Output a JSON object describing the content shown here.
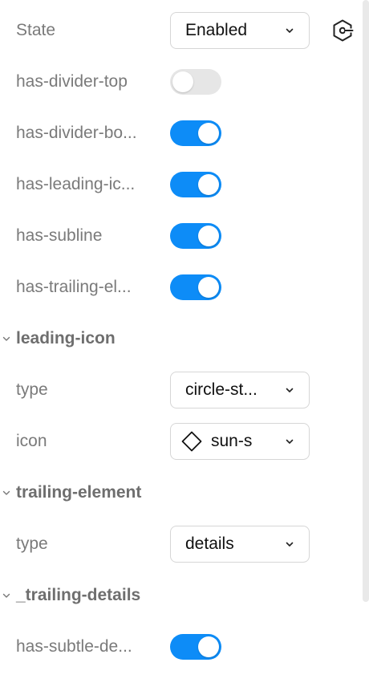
{
  "state": {
    "label": "State",
    "value": "Enabled"
  },
  "toggles": {
    "has_divider_top": {
      "label": "has-divider-top",
      "on": false
    },
    "has_divider_bottom": {
      "label": "has-divider-bo...",
      "on": true
    },
    "has_leading_icon": {
      "label": "has-leading-ic...",
      "on": true
    },
    "has_subline": {
      "label": "has-subline",
      "on": true
    },
    "has_trailing_element": {
      "label": "has-trailing-el...",
      "on": true
    }
  },
  "leading_icon": {
    "section_label": "leading-icon",
    "type_label": "type",
    "type_value": "circle-st...",
    "icon_label": "icon",
    "icon_value": "sun-s"
  },
  "trailing_element": {
    "section_label": "trailing-element",
    "type_label": "type",
    "type_value": "details"
  },
  "trailing_details": {
    "section_label": "_trailing-details",
    "has_subtle_details": {
      "label": "has-subtle-de...",
      "on": true
    }
  },
  "icons": {
    "state_action": "token-link-icon",
    "select_chevron": "chevron-down-icon",
    "section_chevron": "chevron-down-icon",
    "icon_preview": "diamond-icon"
  },
  "colors": {
    "toggle_on": "#0d8cf7",
    "toggle_off": "#e6e6e6",
    "label_text": "#7a7a7a"
  }
}
